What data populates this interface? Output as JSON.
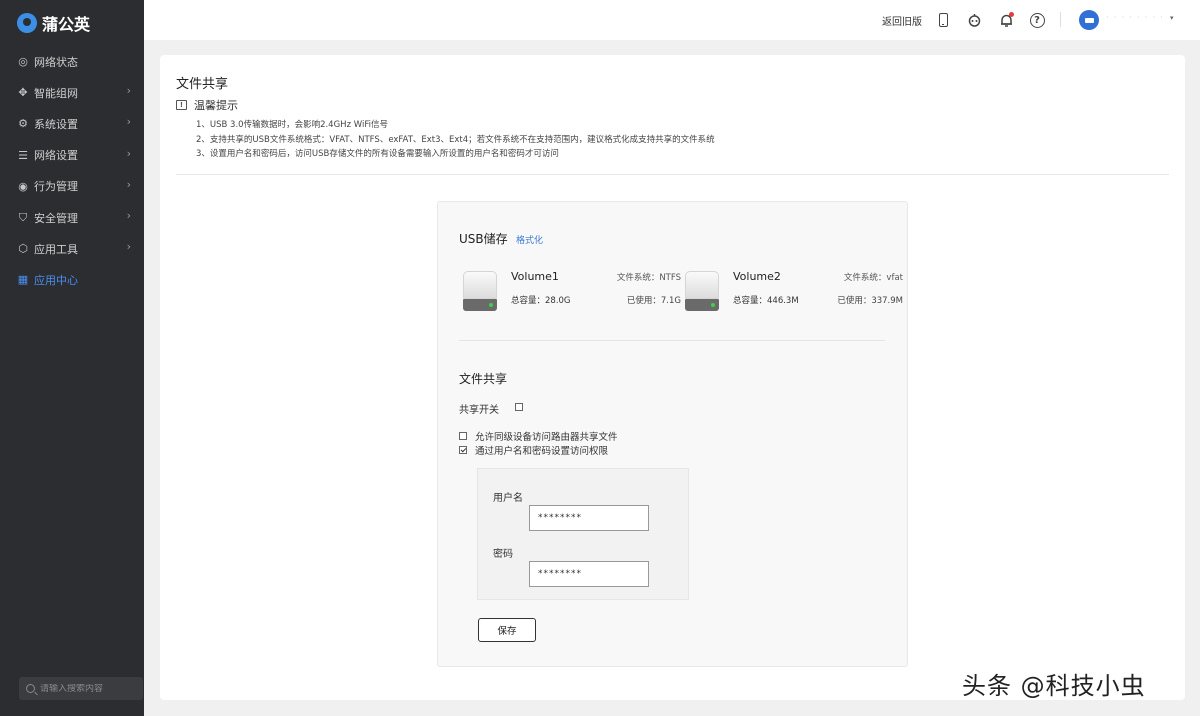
{
  "brand": {
    "name": "蒲公英"
  },
  "sidebar": {
    "items": [
      {
        "label": "网络状态",
        "icon": "globe-icon",
        "glyph": "◎",
        "has_chevron": false
      },
      {
        "label": "智能组网",
        "icon": "network-icon",
        "glyph": "✥",
        "has_chevron": true
      },
      {
        "label": "系统设置",
        "icon": "gear-icon",
        "glyph": "⚙",
        "has_chevron": true
      },
      {
        "label": "网络设置",
        "icon": "sliders-icon",
        "glyph": "☰",
        "has_chevron": true
      },
      {
        "label": "行为管理",
        "icon": "behavior-icon",
        "glyph": "◉",
        "has_chevron": true
      },
      {
        "label": "安全管理",
        "icon": "shield-icon",
        "glyph": "⛉",
        "has_chevron": true
      },
      {
        "label": "应用工具",
        "icon": "tool-icon",
        "glyph": "⬡",
        "has_chevron": true
      },
      {
        "label": "应用中心",
        "icon": "app-grid-icon",
        "glyph": "▦",
        "has_chevron": false,
        "active": true
      }
    ],
    "search_placeholder": "请输入搜索内容"
  },
  "topbar": {
    "old_version": "返回旧版",
    "user_name": "· · · · · ·  · ·",
    "caret": "▾"
  },
  "page": {
    "title": "文件共享",
    "tip_title": "温馨提示",
    "tips": [
      "1、USB 3.0传输数据时，会影响2.4GHz WiFi信号",
      "2、支持共享的USB文件系统格式：VFAT、NTFS、exFAT、Ext3、Ext4；若文件系统不在支持范围内，建议格式化成支持共享的文件系统",
      "3、设置用户名和密码后，访问USB存储文件的所有设备需要输入所设置的用户名和密码才可访问"
    ]
  },
  "usb": {
    "title": "USB储存",
    "format_link": "格式化",
    "volumes": [
      {
        "name": "Volume1",
        "fs": "文件系统：NTFS",
        "total": "总容量：28.0G",
        "used": "已使用：7.1G"
      },
      {
        "name": "Volume2",
        "fs": "文件系统：vfat",
        "total": "总容量：446.3M",
        "used": "已使用：337.9M"
      }
    ]
  },
  "share": {
    "title": "文件共享",
    "switch_label": "共享开关",
    "switch_checked": false,
    "option_lan": "允许同级设备访问路由器共享文件",
    "option_lan_checked": false,
    "option_auth": "通过用户名和密码设置访问权限",
    "option_auth_checked": true,
    "username_label": "用户名",
    "username_value": "********",
    "password_label": "密码",
    "password_value": "********",
    "save_label": "保存"
  },
  "watermark": "头条 @科技小虫"
}
